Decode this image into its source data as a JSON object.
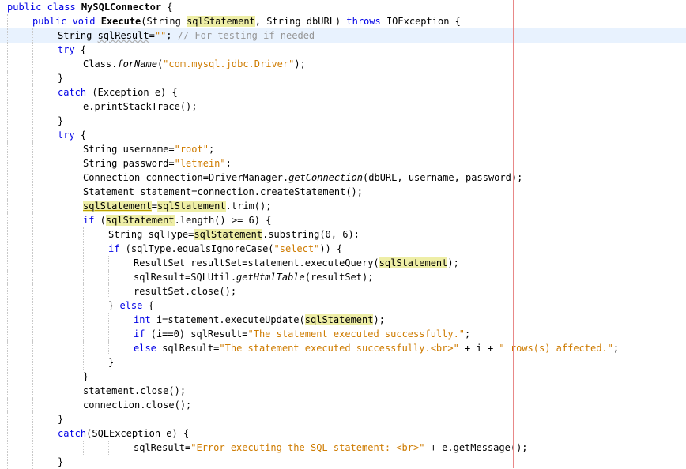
{
  "lines": [
    {
      "indent": 0,
      "segs": [
        {
          "t": "public class ",
          "c": "kw"
        },
        {
          "t": "MySQLConnector",
          "c": "b"
        },
        {
          "t": " {"
        }
      ]
    },
    {
      "indent": 1,
      "segs": [
        {
          "t": "public void ",
          "c": "kw"
        },
        {
          "t": "Execute",
          "c": "b"
        },
        {
          "t": "(String "
        },
        {
          "t": "sqlStatement",
          "c": "hl"
        },
        {
          "t": ", String dbURL) "
        },
        {
          "t": "throws",
          "c": "kw"
        },
        {
          "t": " IOException {"
        }
      ]
    },
    {
      "indent": 2,
      "current": true,
      "segs": [
        {
          "t": "String "
        },
        {
          "t": "sqlResult",
          "c": "sq"
        },
        {
          "t": "="
        },
        {
          "t": "\"\"",
          "c": "str"
        },
        {
          "t": "; "
        },
        {
          "t": "// For testing if needed",
          "c": "cmt"
        }
      ]
    },
    {
      "indent": 2,
      "segs": [
        {
          "t": "try",
          "c": "kw"
        },
        {
          "t": " {"
        }
      ]
    },
    {
      "indent": 3,
      "segs": [
        {
          "t": "Class."
        },
        {
          "t": "forName",
          "c": "it"
        },
        {
          "t": "("
        },
        {
          "t": "\"com.mysql.jdbc.Driver\"",
          "c": "str"
        },
        {
          "t": ");"
        }
      ]
    },
    {
      "indent": 2,
      "segs": [
        {
          "t": "}"
        }
      ]
    },
    {
      "indent": 2,
      "segs": [
        {
          "t": "catch",
          "c": "kw"
        },
        {
          "t": " (Exception e) {"
        }
      ]
    },
    {
      "indent": 3,
      "segs": [
        {
          "t": "e.printStackTrace();"
        }
      ]
    },
    {
      "indent": 2,
      "segs": [
        {
          "t": "}"
        }
      ]
    },
    {
      "indent": 2,
      "segs": [
        {
          "t": "try",
          "c": "kw"
        },
        {
          "t": " {"
        }
      ]
    },
    {
      "indent": 3,
      "segs": [
        {
          "t": "String username="
        },
        {
          "t": "\"root\"",
          "c": "str"
        },
        {
          "t": ";"
        }
      ]
    },
    {
      "indent": 3,
      "segs": [
        {
          "t": "String password="
        },
        {
          "t": "\"letmein\"",
          "c": "str"
        },
        {
          "t": ";"
        }
      ]
    },
    {
      "indent": 3,
      "segs": [
        {
          "t": "Connection connection=DriverManager."
        },
        {
          "t": "getConnection",
          "c": "it"
        },
        {
          "t": "(dbURL, username, password);"
        }
      ]
    },
    {
      "indent": 3,
      "segs": [
        {
          "t": "Statement statement=connection.createStatement();"
        }
      ]
    },
    {
      "indent": 3,
      "segs": [
        {
          "t": "sqlStatement",
          "c": "hl2"
        },
        {
          "t": "="
        },
        {
          "t": "sqlStatement",
          "c": "hl"
        },
        {
          "t": ".trim();"
        }
      ]
    },
    {
      "indent": 3,
      "segs": [
        {
          "t": "if",
          "c": "kw"
        },
        {
          "t": " ("
        },
        {
          "t": "sqlStatement",
          "c": "hl"
        },
        {
          "t": ".length() >= 6) {"
        }
      ]
    },
    {
      "indent": 4,
      "segs": [
        {
          "t": "String sqlType="
        },
        {
          "t": "sqlStatement",
          "c": "hl"
        },
        {
          "t": ".substring(0, 6);"
        }
      ]
    },
    {
      "indent": 4,
      "segs": [
        {
          "t": "if",
          "c": "kw"
        },
        {
          "t": " (sqlType.equalsIgnoreCase("
        },
        {
          "t": "\"select\"",
          "c": "str"
        },
        {
          "t": ")) {"
        }
      ]
    },
    {
      "indent": 5,
      "segs": [
        {
          "t": "ResultSet resultSet=statement.executeQuery("
        },
        {
          "t": "sqlStatement",
          "c": "hl"
        },
        {
          "t": ");"
        }
      ]
    },
    {
      "indent": 5,
      "segs": [
        {
          "t": "sqlResult=SQLUtil."
        },
        {
          "t": "getHtmlTable",
          "c": "it"
        },
        {
          "t": "(resultSet);"
        }
      ]
    },
    {
      "indent": 5,
      "segs": [
        {
          "t": "resultSet.close();"
        }
      ]
    },
    {
      "indent": 4,
      "segs": [
        {
          "t": "} "
        },
        {
          "t": "else",
          "c": "kw"
        },
        {
          "t": " {"
        }
      ]
    },
    {
      "indent": 5,
      "segs": [
        {
          "t": "int",
          "c": "kw"
        },
        {
          "t": " i=statement.executeUpdate("
        },
        {
          "t": "sqlStatement",
          "c": "hl"
        },
        {
          "t": ");"
        }
      ]
    },
    {
      "indent": 5,
      "segs": [
        {
          "t": "if",
          "c": "kw"
        },
        {
          "t": " (i==0) sqlResult="
        },
        {
          "t": "\"The statement executed successfully.\"",
          "c": "str"
        },
        {
          "t": ";"
        }
      ]
    },
    {
      "indent": 5,
      "segs": [
        {
          "t": "else",
          "c": "kw"
        },
        {
          "t": " sqlResult="
        },
        {
          "t": "\"The statement executed successfully.<br>\"",
          "c": "str"
        },
        {
          "t": " + i + "
        },
        {
          "t": "\" rows(s) affected.\"",
          "c": "str"
        },
        {
          "t": ";"
        }
      ]
    },
    {
      "indent": 4,
      "segs": [
        {
          "t": "}"
        }
      ]
    },
    {
      "indent": 3,
      "segs": [
        {
          "t": "}"
        }
      ]
    },
    {
      "indent": 3,
      "segs": [
        {
          "t": "statement.close();"
        }
      ]
    },
    {
      "indent": 3,
      "segs": [
        {
          "t": "connection.close();"
        }
      ]
    },
    {
      "indent": 2,
      "segs": [
        {
          "t": "}"
        }
      ]
    },
    {
      "indent": 2,
      "segs": [
        {
          "t": "catch",
          "c": "kw"
        },
        {
          "t": "(SQLException e) {"
        }
      ]
    },
    {
      "indent": 5,
      "segs": [
        {
          "t": "sqlResult="
        },
        {
          "t": "\"Error executing the SQL statement: <br>\"",
          "c": "str"
        },
        {
          "t": " + e.getMessage();"
        }
      ]
    },
    {
      "indent": 2,
      "segs": [
        {
          "t": "}"
        }
      ]
    }
  ]
}
